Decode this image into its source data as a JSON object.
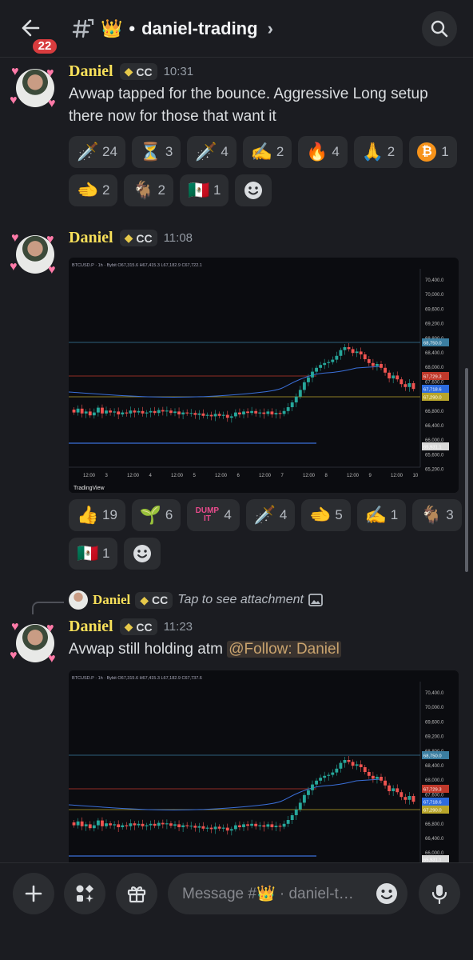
{
  "header": {
    "unread_count": "22",
    "channel_emoji": "👑",
    "channel_separator": "•",
    "channel_name": "daniel-trading",
    "chevron": "›"
  },
  "messages": [
    {
      "author": "Daniel",
      "tag": "CC",
      "time": "10:31",
      "text": "Avwap tapped for the bounce. Aggressive Long setup there now for those that want it",
      "reactions": [
        {
          "emoji": "🗡️",
          "count": "24"
        },
        {
          "emoji": "⏳",
          "count": "3"
        },
        {
          "emoji": "🗡️",
          "count": "4"
        },
        {
          "emoji": "✍️",
          "count": "2"
        },
        {
          "emoji": "🔥",
          "count": "4"
        },
        {
          "emoji": "🙏",
          "count": "2"
        },
        {
          "emoji": "₿",
          "count": "1"
        },
        {
          "emoji": "🫲",
          "count": "2"
        },
        {
          "emoji": "🐐",
          "count": "2"
        },
        {
          "emoji": "🇲🇽",
          "count": "1"
        }
      ]
    },
    {
      "author": "Daniel",
      "tag": "CC",
      "time": "11:08",
      "chart_header": "BTCUSD.P · 1h · Bybit  O67,315.6 H67,415.3 L67,182.9 C67,722.1",
      "chart_watermark": "TradingView",
      "reactions": [
        {
          "emoji": "👍",
          "count": "19"
        },
        {
          "emoji": "🌱",
          "count": "6"
        },
        {
          "emoji": "DUMP IT",
          "count": "4"
        },
        {
          "emoji": "🗡️",
          "count": "4"
        },
        {
          "emoji": "🫲",
          "count": "5"
        },
        {
          "emoji": "✍️",
          "count": "1"
        },
        {
          "emoji": "🐐",
          "count": "3"
        },
        {
          "emoji": "🇲🇽",
          "count": "1"
        }
      ]
    },
    {
      "reply_author": "Daniel",
      "reply_tag": "CC",
      "reply_text": "Tap to see attachment",
      "author": "Daniel",
      "tag": "CC",
      "time": "11:23",
      "text": "Avwap still holding atm",
      "mention": "@Follow: Daniel",
      "chart_header": "BTCUSD.P · 1h · Bybit  O67,315.6 H67,415.3 L67,182.9 C67,737.6"
    }
  ],
  "chart_axis": {
    "y_ticks": [
      "70,400.0",
      "70,000.0",
      "69,600.0",
      "69,200.0",
      "68,800.0",
      "68,400.0",
      "68,000.0",
      "67,600.0",
      "67,200.0",
      "66,800.0",
      "66,400.0",
      "66,000.0",
      "65,600.0",
      "65,200.0"
    ],
    "x_ticks": [
      "12:00",
      "3",
      "12:00",
      "4",
      "12:00",
      "5",
      "12:00",
      "6",
      "12:00",
      "7",
      "12:00",
      "8",
      "12:00",
      "9",
      "12:00",
      "10"
    ],
    "price_labels": {
      "blue": "68,750.0",
      "red": "67,729.3",
      "yellow": "67,290.0",
      "blue2": "67,718.6",
      "low": "65,931.1"
    }
  },
  "bottom_bar": {
    "placeholder": "Message #👑 · daniel-t…"
  },
  "colors": {
    "background": "#1b1c21",
    "author": "#f8e05a",
    "badge": "#d83c3e",
    "pill": "#2b2d31"
  }
}
